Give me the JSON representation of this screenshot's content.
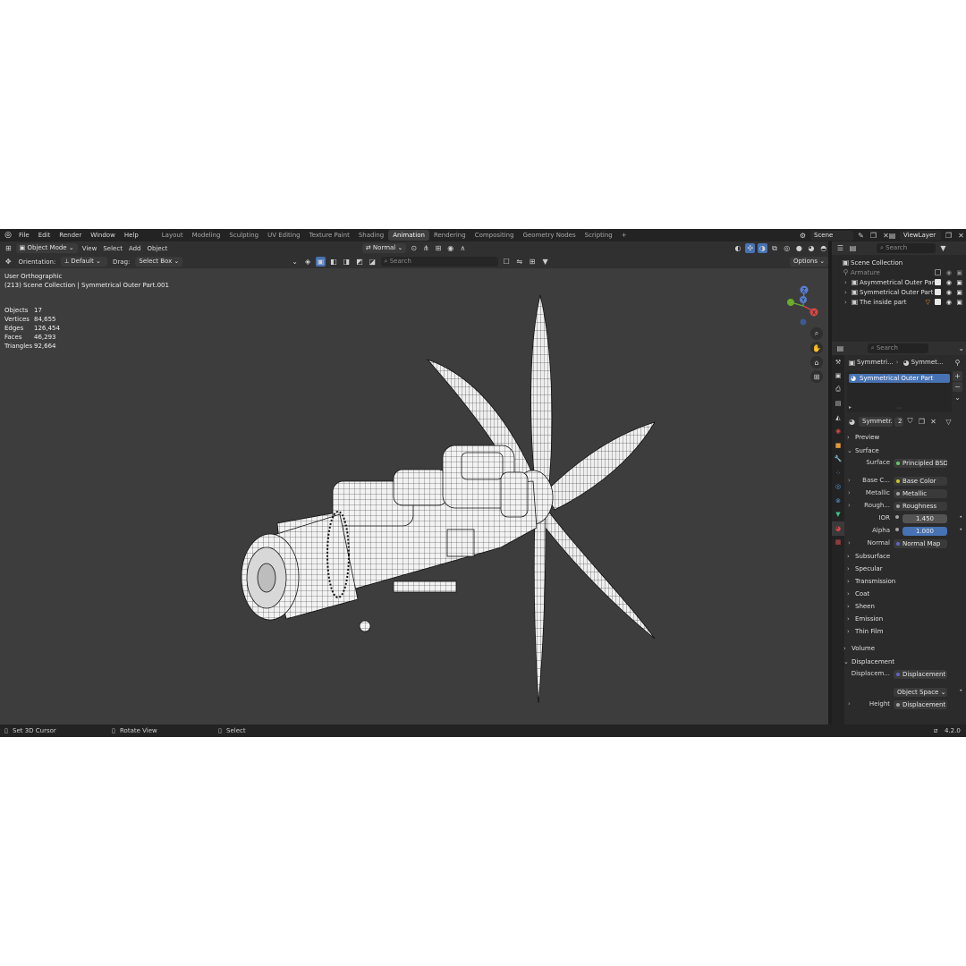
{
  "topbar": {
    "menu": [
      "File",
      "Edit",
      "Render",
      "Window",
      "Help"
    ],
    "workspaces": [
      "Layout",
      "Modeling",
      "Sculpting",
      "UV Editing",
      "Texture Paint",
      "Shading",
      "Animation",
      "Rendering",
      "Compositing",
      "Geometry Nodes",
      "Scripting"
    ],
    "active_workspace": "Animation",
    "add_tab": "+",
    "scene": "Scene",
    "view_layer": "ViewLayer"
  },
  "viewport_header": {
    "mode": "Object Mode",
    "menus": [
      "View",
      "Select",
      "Add",
      "Object"
    ],
    "orientation_label": "Orientation:",
    "orientation_value": "Default",
    "drag_label": "Drag:",
    "drag_value": "Select Box",
    "pivot": "Normal",
    "search_placeholder": "Search",
    "options": "Options"
  },
  "viewport_overlay": {
    "view_name": "User Orthographic",
    "collection_path": "(213) Scene Collection | Symmetrical Outer Part.001",
    "stats": [
      {
        "label": "Objects",
        "value": "17"
      },
      {
        "label": "Vertices",
        "value": "84,655"
      },
      {
        "label": "Edges",
        "value": "126,454"
      },
      {
        "label": "Faces",
        "value": "46,293"
      },
      {
        "label": "Triangles",
        "value": "92,664"
      }
    ],
    "gizmo_axes": {
      "z": "Z",
      "y": "Y",
      "x": "X"
    }
  },
  "outliner": {
    "search_placeholder": "Search",
    "root": "Scene Collection",
    "items": [
      {
        "label": "Armature",
        "dim": true
      },
      {
        "label": "Asymmetrical Outer Part",
        "dim": false
      },
      {
        "label": "Symmetrical Outer Part",
        "dim": false
      },
      {
        "label": "The inside part",
        "dim": false
      }
    ]
  },
  "properties": {
    "search_placeholder": "Search",
    "breadcrumb_object": "Symmetri...",
    "breadcrumb_material": "Symmet...",
    "material_slot": "Symmetrical Outer Part",
    "material_name": "Symmetr...",
    "user_count": "2",
    "sections": {
      "preview": "Preview",
      "surface": "Surface",
      "volume": "Volume",
      "displacement": "Displacement"
    },
    "surface_rows": [
      {
        "key": "Surface",
        "value": "Principled BSDF",
        "dot": "#63c763"
      },
      {
        "key": "Base C...",
        "value": "Base Color",
        "dot": "#c7c729"
      },
      {
        "key": "Metallic",
        "value": "Metallic",
        "dot": "#a1a1a1"
      },
      {
        "key": "Rough...",
        "value": "Roughness",
        "dot": "#a1a1a1"
      }
    ],
    "ior": {
      "key": "IOR",
      "value": "1.450"
    },
    "alpha": {
      "key": "Alpha",
      "value": "1.000"
    },
    "normal": {
      "key": "Normal",
      "value": "Normal Map",
      "dot": "#6363c7"
    },
    "subsections": [
      "Subsurface",
      "Specular",
      "Transmission",
      "Coat",
      "Sheen",
      "Emission",
      "Thin Film"
    ],
    "displacement_rows": {
      "key": "Displacem...",
      "value": "Displacement",
      "space": "Object Space",
      "height_key": "Height",
      "height_value": "Displacement"
    }
  },
  "statusbar": {
    "left": "Set 3D Cursor",
    "middle": "Rotate View",
    "right": "Select",
    "version": "4.2.0"
  },
  "colors": {
    "accent_blue": "#4772b3",
    "viewport_bg": "#3d3d3d",
    "panel_bg": "#2b2b2b"
  }
}
